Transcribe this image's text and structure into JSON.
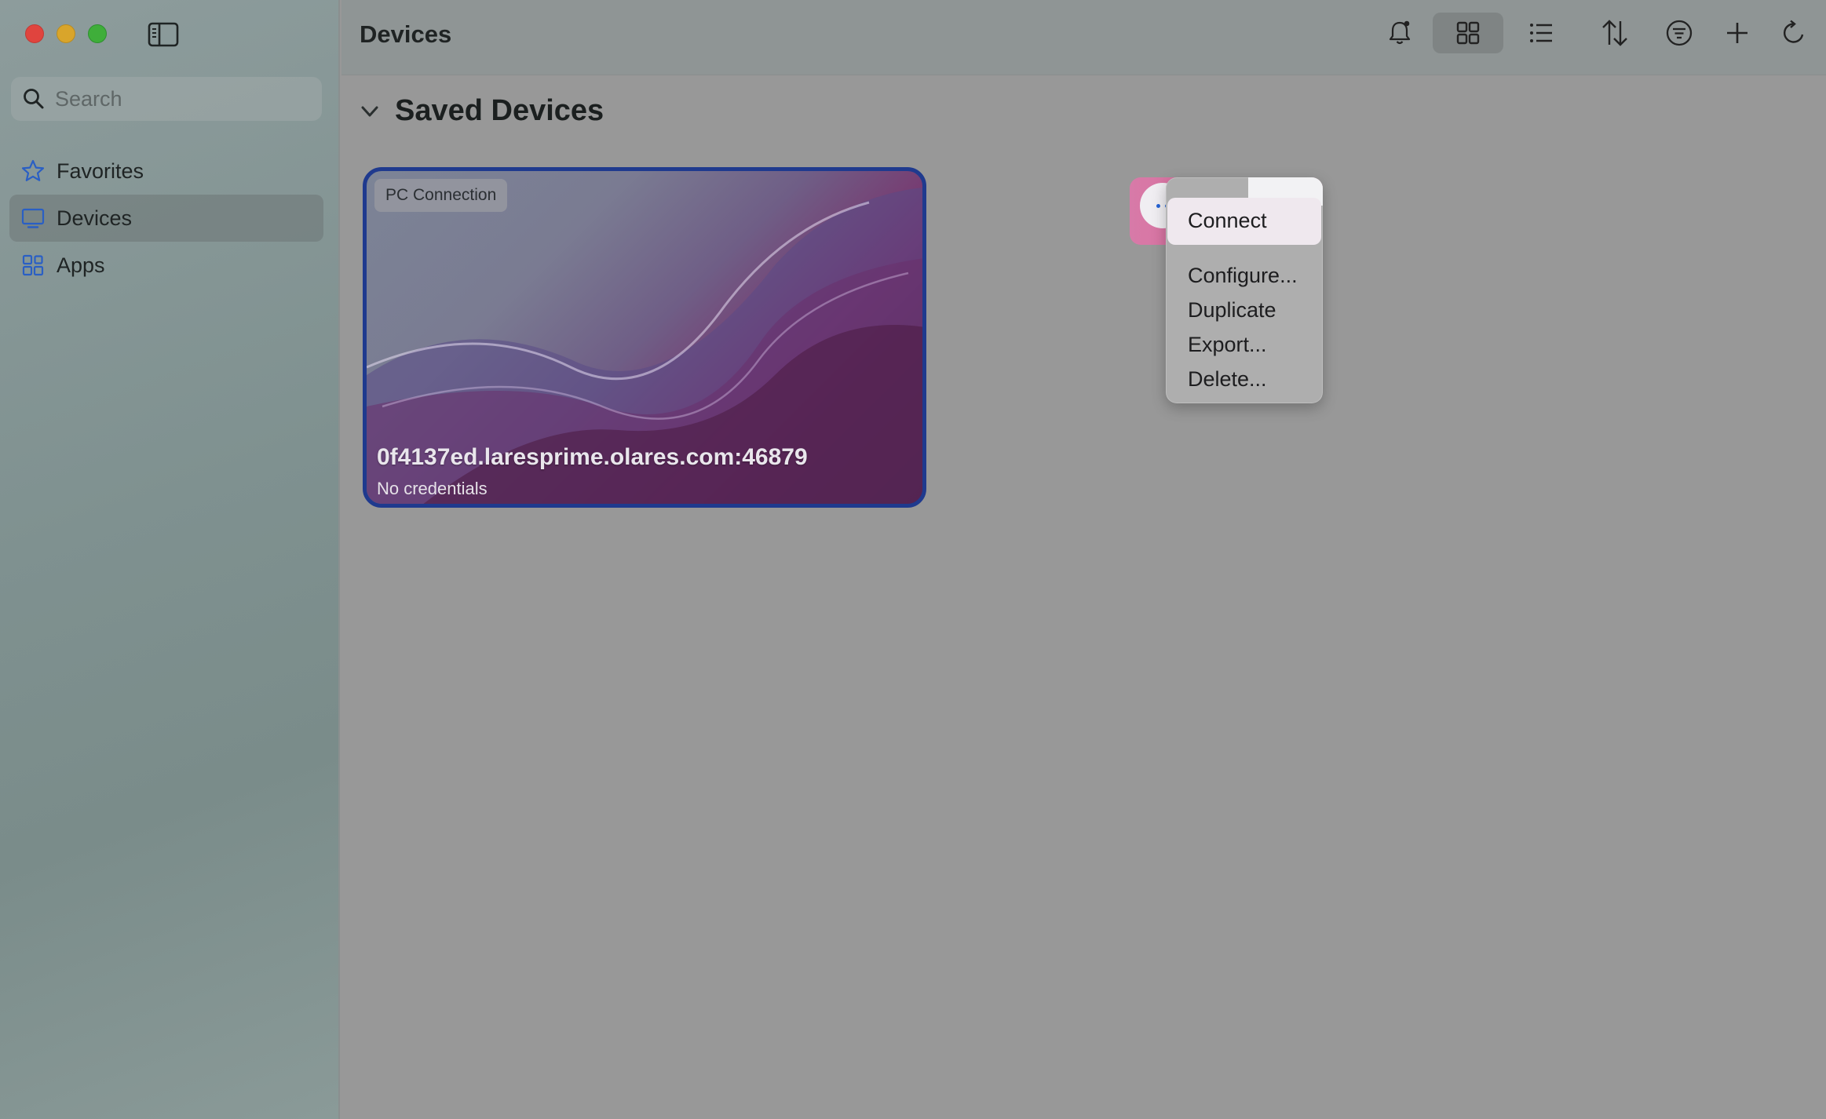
{
  "window": {
    "title": "Devices"
  },
  "sidebar": {
    "search_placeholder": "Search",
    "items": [
      {
        "label": "Favorites",
        "icon": "star-icon"
      },
      {
        "label": "Devices",
        "icon": "display-icon",
        "active": true
      },
      {
        "label": "Apps",
        "icon": "apps-grid-icon"
      }
    ]
  },
  "toolbar": {
    "buttons": [
      "bell-icon",
      "grid-view-icon",
      "list-view-icon",
      "sort-icon",
      "filter-icon",
      "add-icon",
      "refresh-icon"
    ],
    "selected": "grid-view-icon"
  },
  "section": {
    "title": "Saved Devices"
  },
  "card": {
    "tag": "PC Connection",
    "title": "0f4137ed.laresprime.olares.com:46879",
    "subtitle": "No credentials"
  },
  "context_menu": {
    "items": [
      "Connect",
      "Configure...",
      "Duplicate",
      "Export...",
      "Delete..."
    ],
    "highlighted": "Connect"
  },
  "colors": {
    "card_border": "#1f3a8e",
    "close": "#e0443e",
    "minimize": "#d9a52b",
    "zoom": "#3fae3a",
    "more_dots": "#2563d6"
  }
}
